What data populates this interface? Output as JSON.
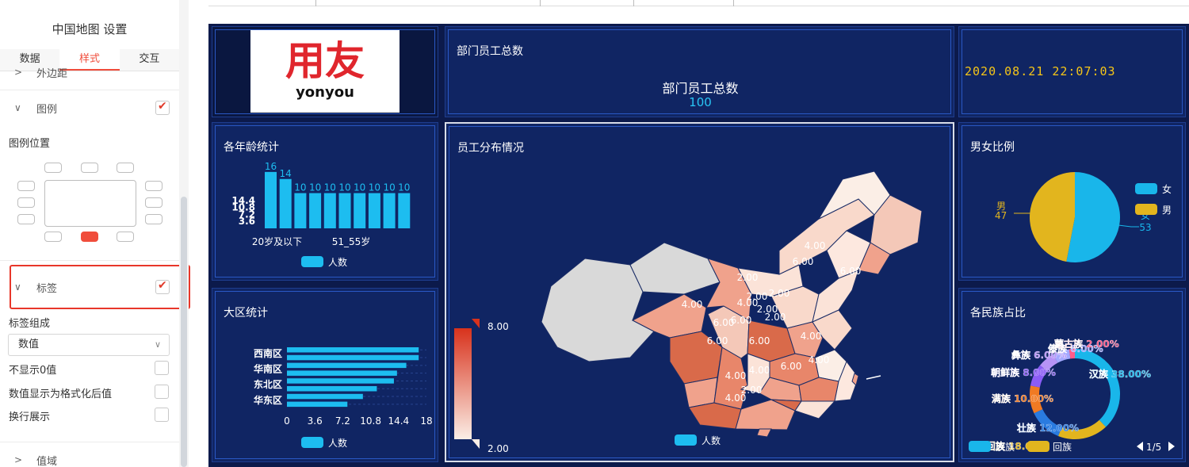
{
  "panel": {
    "title": "中国地图 设置",
    "tabs": [
      "数据",
      "样式",
      "交互"
    ],
    "active_tab": 1,
    "margin_section": "外边距",
    "legend_section": "图例",
    "legend_checked": true,
    "legend_position_label": "图例位置",
    "label_section": "标签",
    "label_checked": true,
    "label_composition_label": "标签组成",
    "label_composition_value": "数值",
    "options": [
      {
        "label": "不显示0值",
        "checked": false
      },
      {
        "label": "数值显示为格式化后值",
        "checked": false
      },
      {
        "label": "换行展示",
        "checked": false
      }
    ],
    "value_range_section": "值域"
  },
  "dash": {
    "logo_text": "用友",
    "logo_sub": "yonyou",
    "staff_card": {
      "title": "部门员工总数",
      "label": "部门员工总数",
      "value": "100"
    },
    "clock": "2020.08.21 22:07:03",
    "age": {
      "title": "各年龄统计",
      "legend": "人数"
    },
    "region": {
      "title": "大区统计",
      "legend": "人数"
    },
    "map": {
      "title": "员工分布情况",
      "legend": "人数",
      "vmax": "8.00",
      "vmin": "2.00"
    },
    "gender": {
      "title": "男女比例"
    },
    "ethnic": {
      "title": "各民族占比",
      "legend_first": "汉族",
      "legend_second": "回族",
      "pager": "1/5"
    }
  },
  "chart_data": [
    {
      "type": "bar",
      "title": "各年龄统计",
      "categories": [
        "20岁及以下",
        "",
        "",
        "",
        "",
        "51_55岁",
        "",
        "",
        "",
        ""
      ],
      "series": [
        {
          "name": "人数",
          "values": [
            16,
            14,
            10,
            10,
            10,
            10,
            10,
            10,
            10,
            10
          ]
        }
      ],
      "ylim": [
        0,
        18
      ],
      "yticks": [
        "3.6",
        "7.2",
        "10.8",
        "14.4"
      ]
    },
    {
      "type": "bar",
      "title": "大区统计",
      "orientation": "horizontal",
      "categories": [
        "西南区",
        "",
        "华南区",
        "",
        "东北区",
        "",
        "华东区",
        ""
      ],
      "series": [
        {
          "name": "人数",
          "values": [
            17,
            17,
            15.4,
            14.2,
            13.8,
            11.6,
            9.8,
            7.8
          ]
        }
      ],
      "xlim": [
        0,
        18
      ],
      "xticks": [
        "0",
        "3.6",
        "7.2",
        "10.8",
        "14.4",
        "18"
      ]
    },
    {
      "type": "pie",
      "title": "男女比例",
      "slices": [
        {
          "label": "女",
          "value": 53,
          "color": "#19b6ea"
        },
        {
          "label": "男",
          "value": 47,
          "color": "#e2b51e"
        }
      ]
    },
    {
      "type": "pie",
      "title": "各民族占比",
      "donut": true,
      "slices": [
        {
          "label": "汉族",
          "value": 38,
          "text": "汉族 38.00%",
          "color": "#19b6ea"
        },
        {
          "label": "回族",
          "value": 18,
          "text": "回族 18.00%",
          "color": "#e2b51e"
        },
        {
          "label": "壮族",
          "value": 12,
          "text": "壮族 12.00%",
          "color": "#2a7be0"
        },
        {
          "label": "满族",
          "value": 10,
          "text": "满族 10.00%",
          "color": "#f07a23"
        },
        {
          "label": "朝鲜族",
          "value": 8,
          "text": "朝鲜族 8.00%",
          "color": "#8b5cf6"
        },
        {
          "label": "彝族",
          "value": 6,
          "text": "彝族 6.00%",
          "color": "#b794f6"
        },
        {
          "label": "傣族",
          "value": 6,
          "text": "傣族 6.00%",
          "color": "#a3a8ff"
        },
        {
          "label": "蒙古族",
          "value": 2,
          "text": "蒙古族 2.00%",
          "color": "#ff5c8a"
        }
      ]
    }
  ],
  "map_labels": [
    "4.00",
    "6.00",
    "2.00",
    "4.00",
    "6.00",
    "6.00",
    "6.00",
    "4.00",
    "4.00",
    "6.00",
    "6.00",
    "2.00",
    "4.00",
    "4.00",
    "6.00",
    "4.00",
    "2.00",
    "2.00",
    "2.00",
    "4.00",
    "2.00"
  ]
}
